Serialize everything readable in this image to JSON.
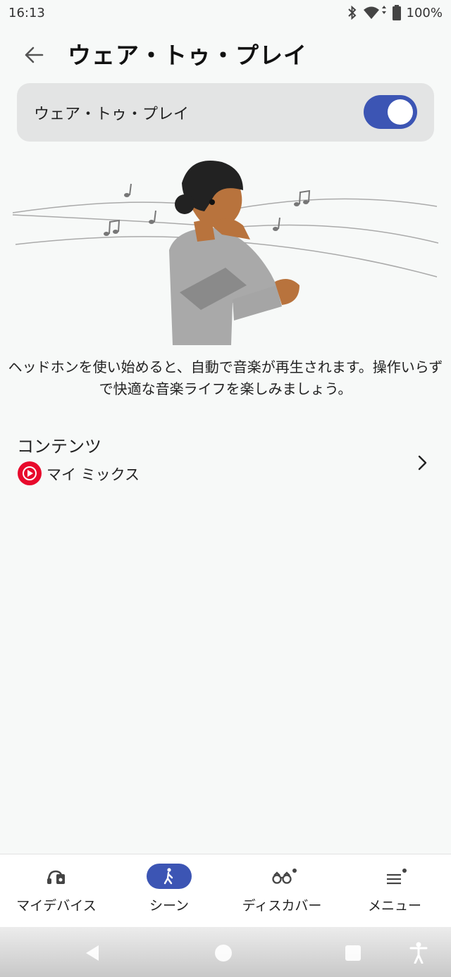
{
  "status_bar": {
    "time": "16:13",
    "battery": "100%"
  },
  "header": {
    "title": "ウェア・トゥ・プレイ"
  },
  "toggle": {
    "label": "ウェア・トゥ・プレイ",
    "state": "on"
  },
  "description": "ヘッドホンを使い始めると、自動で音楽が再生されます。操作いらずで快適な音楽ライフを楽しみましょう。",
  "contents": {
    "title": "コンテンツ",
    "item_label": "マイ ミックス"
  },
  "bottom_nav": [
    {
      "label": "マイデバイス",
      "icon": "headphones-device-icon"
    },
    {
      "label": "シーン",
      "icon": "walking-person-icon",
      "active": true
    },
    {
      "label": "ディスカバー",
      "icon": "binoculars-icon"
    },
    {
      "label": "メニュー",
      "icon": "menu-icon"
    }
  ],
  "colors": {
    "accent": "#3c55b4",
    "background": "#f7f9f8",
    "card": "#e3e4e4",
    "ytm_red": "#e8092c"
  }
}
